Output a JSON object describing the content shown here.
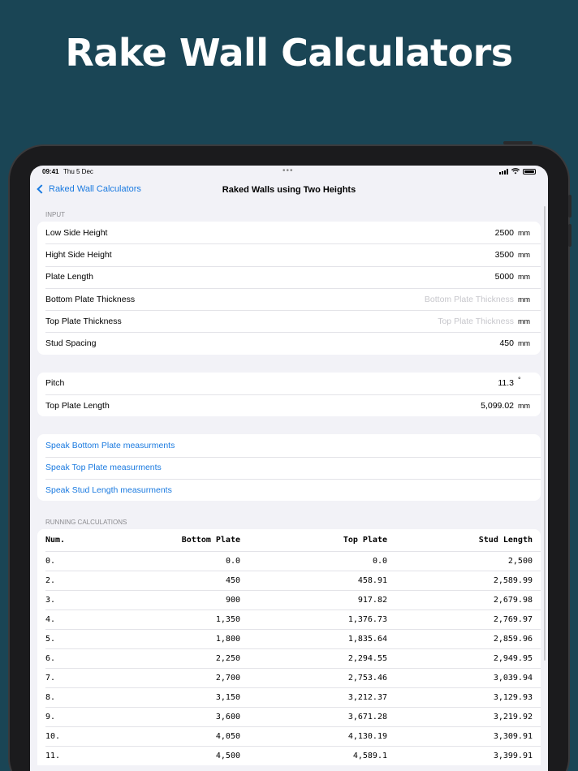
{
  "headline": "Rake Wall Calculators",
  "status": {
    "time": "09:41",
    "date": "Thu 5 Dec"
  },
  "nav": {
    "back_label": "Raked Wall Calculators",
    "title": "Raked Walls using Two Heights"
  },
  "input": {
    "header": "INPUT",
    "rows": [
      {
        "label": "Low Side Height",
        "value": "2500",
        "placeholder": "",
        "unit": "mm"
      },
      {
        "label": "Hight Side Height",
        "value": "3500",
        "placeholder": "",
        "unit": "mm"
      },
      {
        "label": "Plate Length",
        "value": "5000",
        "placeholder": "",
        "unit": "mm"
      },
      {
        "label": "Bottom Plate Thickness",
        "value": "",
        "placeholder": "Bottom Plate Thickness",
        "unit": "mm"
      },
      {
        "label": "Top Plate Thickness",
        "value": "",
        "placeholder": "Top Plate Thickness",
        "unit": "mm"
      },
      {
        "label": "Stud Spacing",
        "value": "450",
        "placeholder": "",
        "unit": "mm"
      }
    ]
  },
  "results": {
    "pitch_label": "Pitch",
    "pitch_value": "11.3",
    "pitch_unit": "°",
    "top_plate_label": "Top Plate Length",
    "top_plate_value": "5,099.02",
    "top_plate_unit": "mm"
  },
  "speak": {
    "bottom": "Speak Bottom Plate measurments",
    "top": "Speak Top Plate measurments",
    "stud": "Speak Stud Length measurments"
  },
  "running": {
    "header": "RUNNING CALCULATIONS",
    "columns": [
      "Num.",
      "Bottom Plate",
      "Top Plate",
      "Stud Length"
    ],
    "rows": [
      [
        "0.",
        "0.0",
        "0.0",
        "2,500"
      ],
      [
        "2.",
        "450",
        "458.91",
        "2,589.99"
      ],
      [
        "3.",
        "900",
        "917.82",
        "2,679.98"
      ],
      [
        "4.",
        "1,350",
        "1,376.73",
        "2,769.97"
      ],
      [
        "5.",
        "1,800",
        "1,835.64",
        "2,859.96"
      ],
      [
        "6.",
        "2,250",
        "2,294.55",
        "2,949.95"
      ],
      [
        "7.",
        "2,700",
        "2,753.46",
        "3,039.94"
      ],
      [
        "8.",
        "3,150",
        "3,212.37",
        "3,129.93"
      ],
      [
        "9.",
        "3,600",
        "3,671.28",
        "3,219.92"
      ],
      [
        "10.",
        "4,050",
        "4,130.19",
        "3,309.91"
      ],
      [
        "11.",
        "4,500",
        "4,589.1",
        "3,399.91"
      ]
    ]
  }
}
